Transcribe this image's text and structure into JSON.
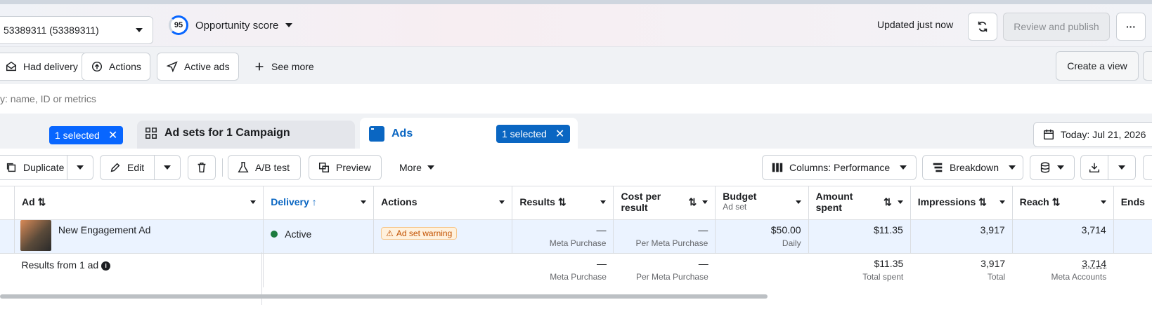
{
  "header": {
    "account_label": "53389311 (53389311)",
    "opportunity_score": "95",
    "opportunity_label": "Opportunity score",
    "updated_text": "Updated just now",
    "review_publish": "Review and publish",
    "more_label": "···"
  },
  "filters": {
    "had_delivery": "Had delivery",
    "actions": "Actions",
    "active_ads": "Active ads",
    "see_more": "See more",
    "create_view": "Create a view"
  },
  "search": {
    "placeholder": "y: name, ID or metrics"
  },
  "tabs": {
    "campaign_selected": "1 selected",
    "adsets_label": "Ad sets for 1 Campaign",
    "ads_label": "Ads",
    "ads_selected": "1 selected",
    "date_label": "Today: Jul 21, 2026"
  },
  "toolbar": {
    "duplicate": "Duplicate",
    "edit": "Edit",
    "ab_test": "A/B test",
    "preview": "Preview",
    "more": "More",
    "columns": "Columns: Performance",
    "breakdown": "Breakdown"
  },
  "table": {
    "headers": {
      "ad": "Ad",
      "delivery": "Delivery",
      "actions": "Actions",
      "results": "Results",
      "cost_per_result": "Cost per result",
      "budget": "Budget",
      "budget_sub": "Ad set",
      "amount_spent": "Amount spent",
      "impressions": "Impressions",
      "reach": "Reach",
      "ends": "Ends"
    },
    "row": {
      "name": "New Engagement Ad",
      "delivery": "Active",
      "warning": "Ad set warning",
      "results": "—",
      "results_sub": "Meta Purchase",
      "cost": "—",
      "cost_sub": "Per Meta Purchase",
      "budget": "$50.00",
      "budget_sub": "Daily",
      "spent": "$11.35",
      "impressions": "3,917",
      "reach": "3,714"
    },
    "summary": {
      "label": "Results from 1 ad",
      "results": "—",
      "results_sub": "Meta Purchase",
      "cost": "—",
      "cost_sub": "Per Meta Purchase",
      "spent": "$11.35",
      "spent_sub": "Total spent",
      "impressions": "3,917",
      "impressions_sub": "Total",
      "reach": "3,714",
      "reach_sub": "Meta Accounts"
    }
  }
}
